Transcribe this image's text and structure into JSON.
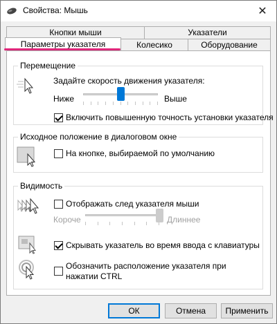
{
  "window": {
    "title": "Свойства: Мышь",
    "close_glyph": "✕",
    "title_icon": "mouse-icon"
  },
  "tabs": {
    "row1": [
      "Кнопки мыши",
      "Указатели"
    ],
    "row2": [
      "Параметры указателя",
      "Колесико",
      "Оборудование"
    ],
    "active": "Параметры указателя"
  },
  "motion": {
    "group_title": "Перемещение",
    "speed_label": "Задайте скорость движения указателя:",
    "slow_label": "Ниже",
    "fast_label": "Выше",
    "speed_level": 0.5,
    "precision_label": "Включить повышенную точность установки указателя",
    "precision_checked": true
  },
  "snap": {
    "group_title": "Исходное положение в диалоговом окне",
    "snap_label": "На кнопке, выбираемой по умолчанию",
    "snap_checked": false
  },
  "visibility": {
    "group_title": "Видимость",
    "trails_label": "Отображать след указателя мыши",
    "trails_checked": false,
    "short_label": "Короче",
    "long_label": "Длиннее",
    "trails_level": 1.0,
    "hide_label": "Скрывать указатель во время ввода с клавиатуры",
    "hide_checked": true,
    "show_location_label": "Обозначить расположение указателя при нажатии CTRL",
    "show_location_checked": false
  },
  "buttons": {
    "ok": "ОК",
    "cancel": "Отмена",
    "apply": "Применить"
  },
  "colors": {
    "accent": "#0078d7",
    "highlight": "#e0267a"
  }
}
